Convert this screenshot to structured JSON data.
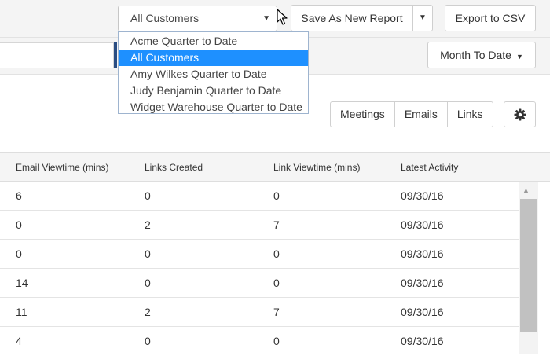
{
  "toolbar": {
    "report_select_value": "All Customers",
    "save_label": "Save As New Report",
    "export_label": "Export to CSV"
  },
  "report_dropdown": {
    "options": [
      "Acme Quarter to Date",
      "All Customers",
      "Amy Wilkes Quarter to Date",
      "Judy Benjamin Quarter to Date",
      "Widget Warehouse Quarter to Date"
    ],
    "selected_index": 1
  },
  "date_range": {
    "label": "Month To Date"
  },
  "filters": {
    "meetings": "Meetings",
    "emails": "Emails",
    "links": "Links"
  },
  "table": {
    "columns": [
      "Email Viewtime (mins)",
      "Links Created",
      "Link Viewtime (mins)",
      "Latest Activity"
    ],
    "rows": [
      [
        "6",
        "0",
        "0",
        "09/30/16"
      ],
      [
        "0",
        "2",
        "7",
        "09/30/16"
      ],
      [
        "0",
        "0",
        "0",
        "09/30/16"
      ],
      [
        "14",
        "0",
        "0",
        "09/30/16"
      ],
      [
        "11",
        "2",
        "7",
        "09/30/16"
      ],
      [
        "4",
        "0",
        "0",
        "09/30/16"
      ]
    ]
  },
  "colors": {
    "selected_option": "#1e90ff",
    "accent": "#2a4d83"
  },
  "icons": {
    "settings": "gear-icon",
    "dropdown": "caret-down-icon",
    "scroll_up": "arrow-up-icon",
    "pointer": "mouse-pointer-icon"
  }
}
